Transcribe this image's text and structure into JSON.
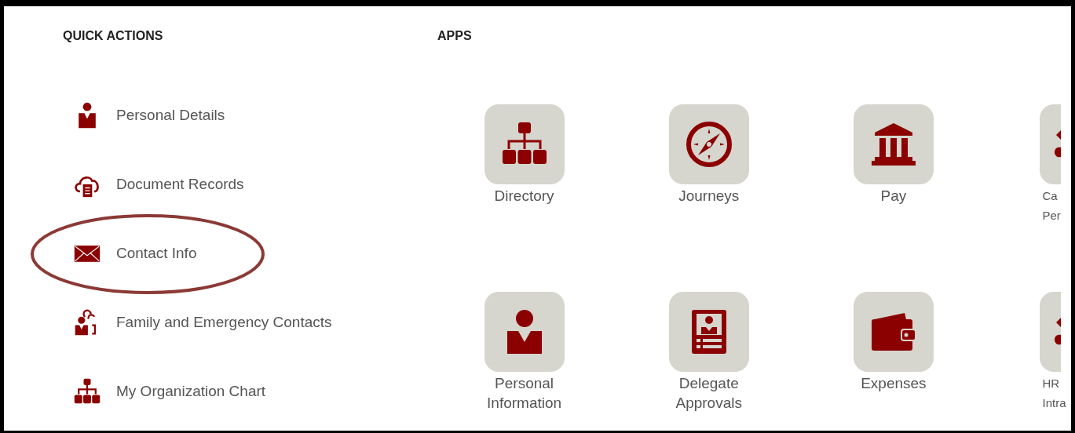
{
  "quick_actions": {
    "title": "QUICK ACTIONS",
    "items": [
      {
        "label": "Personal Details",
        "circled": false
      },
      {
        "label": "Document Records",
        "circled": false
      },
      {
        "label": "Contact Info",
        "circled": true
      },
      {
        "label": "Family and Emergency Contacts",
        "circled": false
      },
      {
        "label": "My Organization Chart",
        "circled": false
      }
    ]
  },
  "apps": {
    "title": "APPS",
    "rows": [
      [
        {
          "kind": "full",
          "lines": [
            "Directory"
          ]
        },
        {
          "kind": "full",
          "lines": [
            "Journeys"
          ]
        },
        {
          "kind": "full",
          "lines": [
            "Pay"
          ]
        },
        {
          "kind": "cut",
          "lines": [
            "Ca",
            "Per"
          ]
        }
      ],
      [
        {
          "kind": "full",
          "lines": [
            "Personal",
            "Information"
          ]
        },
        {
          "kind": "full",
          "lines": [
            "Delegate",
            "Approvals"
          ]
        },
        {
          "kind": "full",
          "lines": [
            "Expenses"
          ]
        },
        {
          "kind": "cut",
          "lines": [
            "HR",
            "Intra"
          ]
        }
      ]
    ]
  }
}
